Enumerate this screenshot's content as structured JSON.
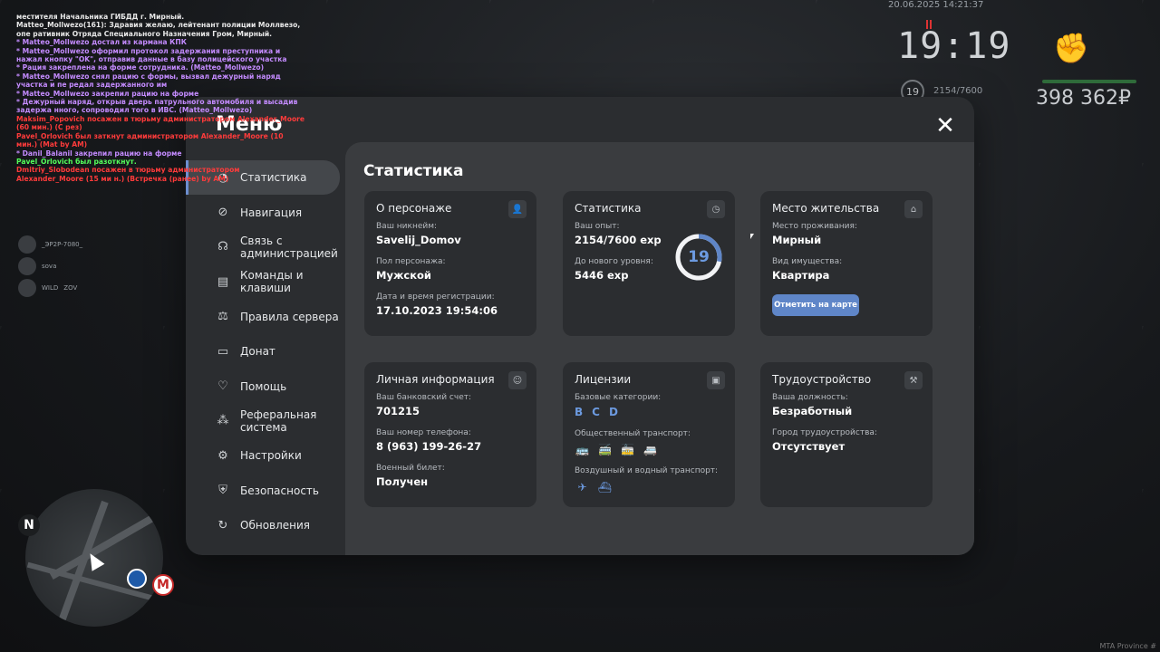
{
  "hud": {
    "datetime": "20.06.2025 14:21:37",
    "time": "19:19",
    "level": "19",
    "exp": "2154/7600",
    "money": "398 362₽",
    "watermark": "MTA Province #"
  },
  "chat": [
    {
      "color": "white",
      "text": "местителя Начальника ГИБДД г. Мирный."
    },
    {
      "color": "white",
      "text": "Matteo_Mollwezo(161): Здравия желаю, лейтенант полиции Моллвезо, опе ративник Отряда Специального Назначения Гром, Мирный."
    },
    {
      "color": "purple",
      "text": "* Matteo_Mollwezo достал из кармана КПК"
    },
    {
      "color": "purple",
      "text": "* Matteo_Mollwezo оформил протокол задержания преступника и нажал кнопку \"OK\", отправив данные в базу полицейского участка"
    },
    {
      "color": "purple",
      "text": "* Рация закреплена на форме сотрудника. (Matteo_Mollwezo)"
    },
    {
      "color": "purple",
      "text": "* Matteo_Mollwezo снял рацию с формы, вызвал дежурный наряд участка и пе редал задержанного им"
    },
    {
      "color": "purple",
      "text": "* Matteo_Mollwezo закрепил рацию на форме"
    },
    {
      "color": "purple",
      "text": "* Дежурный наряд, открыв дверь патрульного автомобиля и высадив задержа нного, сопроводил того в ИВС. (Matteo_Mollwezo)"
    },
    {
      "color": "red",
      "text": "Maksim_Popovich посажен в тюрьму администратором Alexander_Moore (60 мин.) (C рез)"
    },
    {
      "color": "red",
      "text": "Pavel_Orlovich был заткнут администратором Alexander_Moore (10 мин.) (Mat by AM)"
    },
    {
      "color": "purple",
      "text": "* Danil_Balanil закрепил рацию на форме"
    },
    {
      "color": "green",
      "text": "Pavel_Orlovich был разоткнут."
    },
    {
      "color": "red",
      "text": "Dmitriy_Slobodean посажен в тюрьму администратором Alexander_Moore (15 ми н.) (Встречка (ранее) by AM)"
    }
  ],
  "players": [
    {
      "name": "_ЭР2Р-7080_"
    },
    {
      "name": "sova"
    },
    {
      "name": "WILD",
      "tag": "ZOV"
    }
  ],
  "minimap": {
    "north": "N",
    "metro": "М"
  },
  "menu": {
    "title": "Меню",
    "nav": [
      {
        "id": "statistics",
        "label": "Статистика",
        "icon": "pie-chart-icon",
        "active": true
      },
      {
        "id": "navigation",
        "label": "Навигация",
        "icon": "compass-icon"
      },
      {
        "id": "admin-contact",
        "label": "Связь с администрацией",
        "icon": "headset-icon"
      },
      {
        "id": "commands",
        "label": "Команды и клавиши",
        "icon": "document-icon"
      },
      {
        "id": "rules",
        "label": "Правила сервера",
        "icon": "scales-icon"
      },
      {
        "id": "donate",
        "label": "Донат",
        "icon": "wallet-icon"
      },
      {
        "id": "help",
        "label": "Помощь",
        "icon": "heart-hand-icon"
      },
      {
        "id": "referral",
        "label": "Реферальная система",
        "icon": "network-icon"
      },
      {
        "id": "settings",
        "label": "Настройки",
        "icon": "gear-icon"
      },
      {
        "id": "security",
        "label": "Безопасность",
        "icon": "shield-icon"
      },
      {
        "id": "updates",
        "label": "Обновления",
        "icon": "refresh-icon"
      }
    ]
  },
  "content": {
    "title": "Статистика",
    "character": {
      "title": "О персонаже",
      "nick_label": "Ваш никнейм:",
      "nick": "Savelij_Domov",
      "gender_label": "Пол персонажа:",
      "gender": "Мужской",
      "reg_label": "Дата и время регистрации:",
      "reg": "17.10.2023 19:54:06"
    },
    "stats": {
      "title": "Статистика",
      "exp_label": "Ваш опыт:",
      "exp": "2154/7600 exp",
      "next_label": "До нового уровня:",
      "next": "5446 exp",
      "level": "19",
      "progress": 0.283
    },
    "residence": {
      "title": "Место жительства",
      "place_label": "Место проживания:",
      "place": "Мирный",
      "property_label": "Вид имущества:",
      "property": "Квартира",
      "map_button": "Отметить на карте"
    },
    "personal": {
      "title": "Личная информация",
      "bank_label": "Ваш банковский счет:",
      "bank": "701215",
      "phone_label": "Ваш номер телефона:",
      "phone": "8 (963) 199-26-27",
      "military_label": "Военный билет:",
      "military": "Получен"
    },
    "licenses": {
      "title": "Лицензии",
      "base_label": "Базовые категории:",
      "categories": [
        "B",
        "C",
        "D"
      ],
      "public_label": "Общественный транспорт:",
      "air_label": "Воздушный и водный транспорт:"
    },
    "employment": {
      "title": "Трудоустройство",
      "position_label": "Ваша должность:",
      "position": "Безработный",
      "city_label": "Город трудоустройства:",
      "city": "Отсутствует"
    }
  }
}
